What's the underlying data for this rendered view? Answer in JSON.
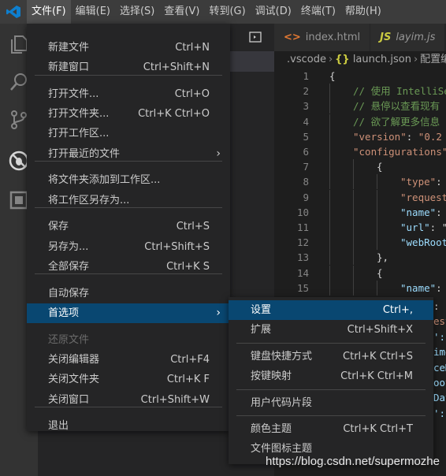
{
  "menubar": {
    "items": [
      {
        "label": "文件(F)",
        "active": true
      },
      {
        "label": "编辑(E)"
      },
      {
        "label": "选择(S)"
      },
      {
        "label": "查看(V)"
      },
      {
        "label": "转到(G)"
      },
      {
        "label": "调试(D)"
      },
      {
        "label": "终端(T)"
      },
      {
        "label": "帮助(H)"
      }
    ]
  },
  "tabs": [
    {
      "icon": "<>",
      "label": "index.html"
    },
    {
      "icon": "JS",
      "label": "layim.js"
    }
  ],
  "breadcrumb": {
    "folder": ".vscode",
    "file_icon": "{}",
    "file": "launch.json",
    "next": "配置编"
  },
  "file_menu": {
    "items": [
      {
        "label": "新建文件",
        "shortcut": "Ctrl+N"
      },
      {
        "label": "新建窗口",
        "shortcut": "Ctrl+Shift+N"
      },
      {
        "label": "打开文件...",
        "shortcut": "Ctrl+O"
      },
      {
        "label": "打开文件夹...",
        "shortcut": "Ctrl+K Ctrl+O"
      },
      {
        "label": "打开工作区..."
      },
      {
        "label": "打开最近的文件",
        "submenu_arrow": "›"
      },
      {
        "label": "将文件夹添加到工作区..."
      },
      {
        "label": "将工作区另存为..."
      },
      {
        "label": "保存",
        "shortcut": "Ctrl+S"
      },
      {
        "label": "另存为...",
        "shortcut": "Ctrl+Shift+S"
      },
      {
        "label": "全部保存",
        "shortcut": "Ctrl+K S"
      },
      {
        "label": "自动保存"
      },
      {
        "label": "首选项",
        "submenu_arrow": "›",
        "selected": true
      },
      {
        "label": "还原文件",
        "disabled": true
      },
      {
        "label": "关闭编辑器",
        "shortcut": "Ctrl+F4"
      },
      {
        "label": "关闭文件夹",
        "shortcut": "Ctrl+K F"
      },
      {
        "label": "关闭窗口",
        "shortcut": "Ctrl+Shift+W"
      },
      {
        "label": "退出"
      }
    ]
  },
  "pref_menu": {
    "items": [
      {
        "label": "设置",
        "shortcut": "Ctrl+,",
        "selected": true
      },
      {
        "label": "扩展",
        "shortcut": "Ctrl+Shift+X"
      },
      {
        "label": "键盘快捷方式",
        "shortcut": "Ctrl+K Ctrl+S"
      },
      {
        "label": "按键映射",
        "shortcut": "Ctrl+K Ctrl+M"
      },
      {
        "label": "用户代码片段"
      },
      {
        "label": "颜色主题",
        "shortcut": "Ctrl+K Ctrl+T"
      },
      {
        "label": "文件图标主题"
      }
    ]
  },
  "editor": {
    "lines": [
      {
        "n": "1",
        "indent": 0,
        "tokens": [
          {
            "t": "{",
            "c": "punc"
          }
        ]
      },
      {
        "n": "2",
        "indent": 1,
        "tokens": [
          {
            "t": "// 使用 IntelliSense",
            "c": "comment"
          }
        ]
      },
      {
        "n": "3",
        "indent": 1,
        "tokens": [
          {
            "t": "// 悬停以查看现有",
            "c": "comment"
          }
        ]
      },
      {
        "n": "4",
        "indent": 1,
        "tokens": [
          {
            "t": "// 欲了解更多信息",
            "c": "comment"
          }
        ]
      },
      {
        "n": "5",
        "indent": 1,
        "tokens": [
          {
            "t": "\"version\"",
            "c": "str"
          },
          {
            "t": ": ",
            "c": "punc"
          },
          {
            "t": "\"0.2",
            "c": "str"
          }
        ]
      },
      {
        "n": "6",
        "indent": 1,
        "tokens": [
          {
            "t": "\"configurations\"",
            "c": "str"
          }
        ]
      },
      {
        "n": "7",
        "indent": 2,
        "tokens": [
          {
            "t": "{",
            "c": "punc"
          }
        ]
      },
      {
        "n": "8",
        "indent": 3,
        "tokens": [
          {
            "t": "\"type\"",
            "c": "str"
          },
          {
            "t": ":",
            "c": "punc"
          }
        ]
      },
      {
        "n": "9",
        "indent": 3,
        "tokens": [
          {
            "t": "\"request",
            "c": "str"
          }
        ]
      },
      {
        "n": "10",
        "indent": 3,
        "tokens": [
          {
            "t": "\"name\"",
            "c": "key"
          },
          {
            "t": ":",
            "c": "punc"
          }
        ]
      },
      {
        "n": "11",
        "indent": 3,
        "tokens": [
          {
            "t": "\"url\"",
            "c": "key"
          },
          {
            "t": ": \"",
            "c": "punc"
          }
        ]
      },
      {
        "n": "12",
        "indent": 3,
        "tokens": [
          {
            "t": "\"webRoot",
            "c": "key"
          }
        ]
      },
      {
        "n": "13",
        "indent": 2,
        "tokens": [
          {
            "t": "},",
            "c": "punc"
          }
        ]
      },
      {
        "n": "14",
        "indent": 2,
        "tokens": [
          {
            "t": "{",
            "c": "punc"
          }
        ]
      },
      {
        "n": "15",
        "indent": 3,
        "tokens": [
          {
            "t": "\"name\"",
            "c": "key"
          },
          {
            "t": ":",
            "c": "punc"
          }
        ]
      }
    ]
  },
  "editor_tail": [
    {
      "text": ":",
      "c": "punc"
    },
    {
      "text": "est",
      "c": "str"
    },
    {
      "text": "':",
      "c": "key"
    },
    {
      "text": "ime",
      "c": "key"
    },
    {
      "text": "ceM",
      "c": "key"
    },
    {
      "text": "oot",
      "c": "key"
    },
    {
      "text": "Dat",
      "c": "key"
    },
    {
      "text": "':s",
      "c": "key"
    }
  ],
  "watermark": "https://blog.csdn.net/supermozhe",
  "colors": {
    "menu_bg": "#252526",
    "selection": "#094771",
    "menubar": "#3c3c3c",
    "activity_bar": "#333333"
  },
  "icons": [
    "vscode-logo-icon",
    "explorer-icon",
    "search-icon",
    "source-control-icon",
    "debug-icon",
    "extensions-icon",
    "split-editor-icon"
  ]
}
